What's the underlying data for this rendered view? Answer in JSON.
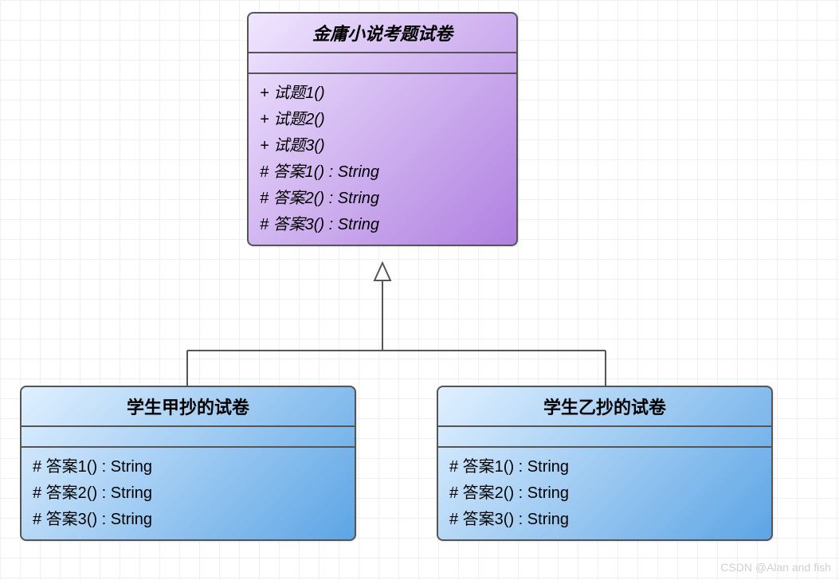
{
  "watermark": "CSDN @Alan and fish",
  "parent_class": {
    "name": "金庸小说考题试卷",
    "methods": [
      "+ 试题1()",
      "+ 试题2()",
      "+ 试题3()",
      "# 答案1()  : String",
      "# 答案2()  : String",
      "# 答案3()  : String"
    ]
  },
  "child_left": {
    "name": "学生甲抄的试卷",
    "methods": [
      "# 答案1()  : String",
      "# 答案2()  : String",
      "# 答案3()  : String"
    ]
  },
  "child_right": {
    "name": "学生乙抄的试卷",
    "methods": [
      "# 答案1()  : String",
      "# 答案2()  : String",
      "# 答案3()  : String"
    ]
  }
}
